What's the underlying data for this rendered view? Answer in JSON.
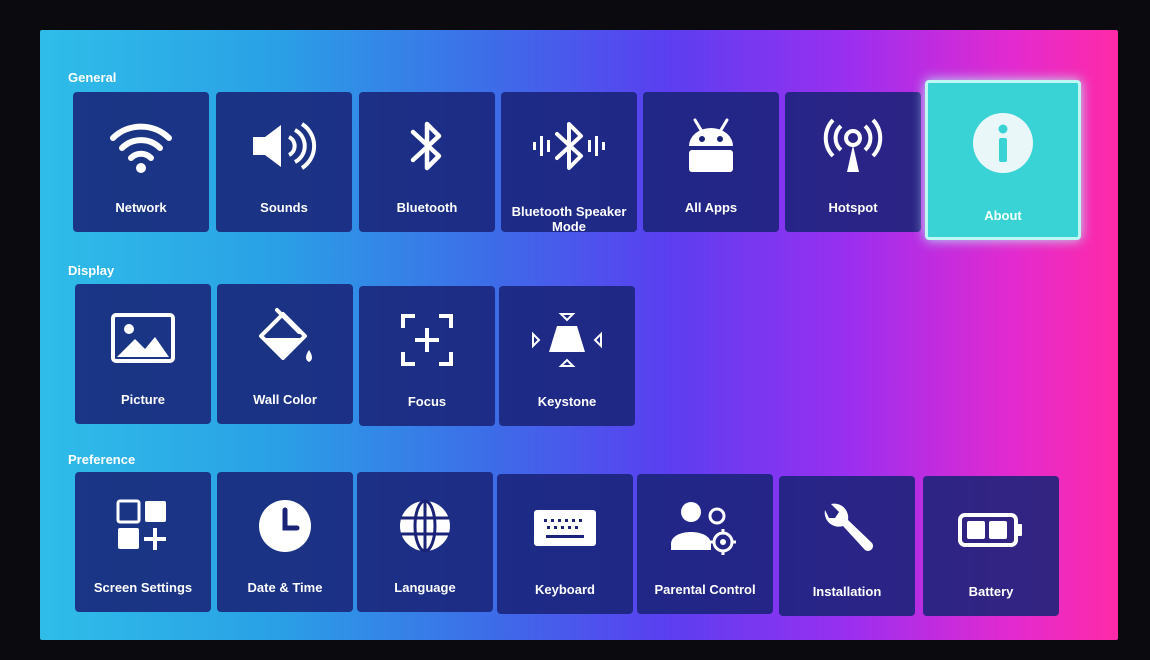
{
  "sections": {
    "general": {
      "label": "General",
      "items": [
        {
          "label": "Network",
          "icon": "wifi-icon"
        },
        {
          "label": "Sounds",
          "icon": "speaker-icon"
        },
        {
          "label": "Bluetooth",
          "icon": "bluetooth-icon"
        },
        {
          "label": "Bluetooth Speaker Mode",
          "icon": "bluetooth-speaker-icon"
        },
        {
          "label": "All Apps",
          "icon": "android-icon"
        },
        {
          "label": "Hotspot",
          "icon": "hotspot-icon"
        },
        {
          "label": "About",
          "icon": "info-icon",
          "selected": true
        }
      ]
    },
    "display": {
      "label": "Display",
      "items": [
        {
          "label": "Picture",
          "icon": "picture-icon"
        },
        {
          "label": "Wall Color",
          "icon": "paint-bucket-icon"
        },
        {
          "label": "Focus",
          "icon": "focus-icon"
        },
        {
          "label": "Keystone",
          "icon": "keystone-icon"
        }
      ]
    },
    "preference": {
      "label": "Preference",
      "items": [
        {
          "label": "Screen Settings",
          "icon": "grid-add-icon"
        },
        {
          "label": "Date & Time",
          "icon": "clock-icon"
        },
        {
          "label": "Language",
          "icon": "globe-icon"
        },
        {
          "label": "Keyboard",
          "icon": "keyboard-icon"
        },
        {
          "label": "Parental Control",
          "icon": "parental-control-icon"
        },
        {
          "label": "Installation",
          "icon": "wrench-icon"
        },
        {
          "label": "Battery",
          "icon": "battery-icon"
        }
      ]
    }
  },
  "colors": {
    "tile": "#1a2378",
    "selected_tile": "#39d3d6",
    "text": "#ffffff"
  }
}
